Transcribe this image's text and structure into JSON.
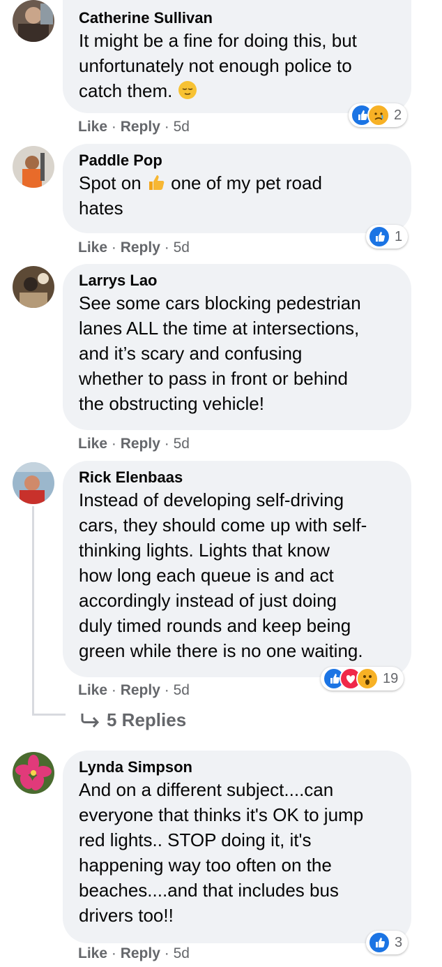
{
  "comments": [
    {
      "name": "Catherine Sullivan",
      "lines": [
        "It might be a fine for doing this, but",
        "unfortunately not enough police to",
        "catch them."
      ],
      "like": "Like",
      "reply": "Reply",
      "time": "5d",
      "reactions": [
        "like-icon",
        "sad-icon"
      ],
      "reaction_count": "2"
    },
    {
      "name": "Paddle Pop",
      "line1a": "Spot on",
      "line1b": "one of my pet road",
      "line2": "hates",
      "like": "Like",
      "reply": "Reply",
      "time": "5d",
      "reactions": [
        "like-icon"
      ],
      "reaction_count": "1"
    },
    {
      "name": "Larrys Lao",
      "lines": [
        "See some cars blocking pedestrian",
        "lanes ALL the time at intersections,",
        "and it’s scary and confusing",
        "whether to pass in front or behind",
        "the obstructing vehicle!"
      ],
      "like": "Like",
      "reply": "Reply",
      "time": "5d"
    },
    {
      "name": "Rick Elenbaas",
      "lines": [
        "Instead of developing self-driving",
        "cars, they should come up with self-",
        "thinking lights. Lights that know",
        "how long each queue is and act",
        "accordingly instead of just doing",
        "duly timed rounds and keep being",
        "green while there is no one waiting."
      ],
      "like": "Like",
      "reply": "Reply",
      "time": "5d",
      "reactions": [
        "like-icon",
        "love-icon",
        "wow-icon"
      ],
      "reaction_count": "19",
      "replies_label": "5 Replies"
    },
    {
      "name": "Lynda Simpson",
      "lines": [
        "And on a different subject....can",
        "everyone that thinks it's OK to jump",
        "red lights.. STOP doing it, it's",
        "happening way too often on the",
        "beaches....and that includes bus",
        "drivers too!!"
      ],
      "like": "Like",
      "reply": "Reply",
      "time": "5d",
      "reactions": [
        "like-icon"
      ],
      "reaction_count": "3"
    }
  ],
  "separator": " · ",
  "colors": {
    "bubble": "#f0f2f5",
    "meta": "#65676b",
    "like": "#1b74e4",
    "love": "#f02849",
    "wow": "#f7b125"
  }
}
